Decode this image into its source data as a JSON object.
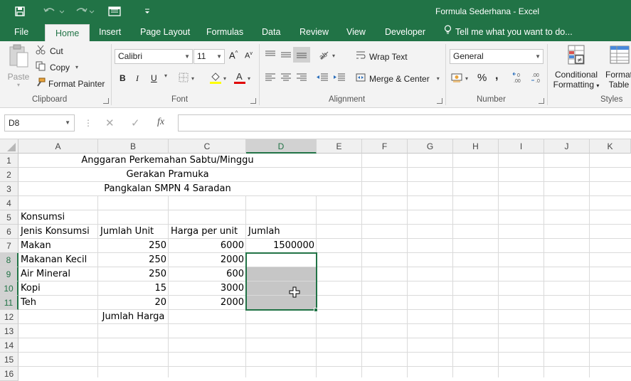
{
  "window": {
    "title": "Formula Sederhana - Excel",
    "accent_color": "#217346"
  },
  "tabs": [
    {
      "label": "File"
    },
    {
      "label": "Home",
      "active": true
    },
    {
      "label": "Insert"
    },
    {
      "label": "Page Layout"
    },
    {
      "label": "Formulas"
    },
    {
      "label": "Data"
    },
    {
      "label": "Review"
    },
    {
      "label": "View"
    },
    {
      "label": "Developer"
    }
  ],
  "tell_me": "Tell me what you want to do...",
  "ribbon": {
    "clipboard": {
      "paste": "Paste",
      "cut": "Cut",
      "copy": "Copy",
      "format_painter": "Format Painter",
      "label": "Clipboard"
    },
    "font": {
      "font_name": "Calibri",
      "font_size": "11",
      "bold": "B",
      "italic": "I",
      "underline": "U",
      "label": "Font"
    },
    "alignment": {
      "wrap_text": "Wrap Text",
      "merge_center": "Merge & Center",
      "label": "Alignment"
    },
    "number": {
      "format": "General",
      "percent": "%",
      "comma": ",",
      "label": "Number"
    },
    "styles": {
      "conditional_formatting_1": "Conditional",
      "conditional_formatting_2": "Formatting",
      "format_table_1": "Format",
      "format_table_2": "Table",
      "label": "Styles"
    }
  },
  "formula_bar": {
    "name_box": "D8",
    "fx": "fx",
    "content": ""
  },
  "grid": {
    "columns": [
      "A",
      "B",
      "C",
      "D",
      "E",
      "F",
      "G",
      "H",
      "I",
      "J",
      "K"
    ],
    "selected_column": "D",
    "rows": [
      "1",
      "2",
      "3",
      "4",
      "5",
      "6",
      "7",
      "8",
      "9",
      "10",
      "11",
      "12",
      "13",
      "14",
      "15",
      "16"
    ],
    "selected_rows": [
      "8",
      "9",
      "10",
      "11"
    ],
    "cells": {
      "title1": "Anggaran Perkemahan Sabtu/Minggu",
      "title2": "Gerakan Pramuka",
      "title3": "Pangkalan SMPN 4 Saradan",
      "A5": "Konsumsi",
      "A6": "Jenis Konsumsi",
      "B6": "Jumlah Unit",
      "C6": "Harga per unit",
      "D6": "Jumlah",
      "A7": "Makan",
      "B7": "250",
      "C7": "6000",
      "D7": "1500000",
      "A8": "Makanan Kecil",
      "B8": "250",
      "C8": "2000",
      "A9": "Air Mineral",
      "B9": "250",
      "C9": "600",
      "A10": "Kopi",
      "B10": "15",
      "C10": "3000",
      "A11": "Teh",
      "B11": "20",
      "C11": "2000",
      "B12": "Jumlah Harga"
    }
  }
}
